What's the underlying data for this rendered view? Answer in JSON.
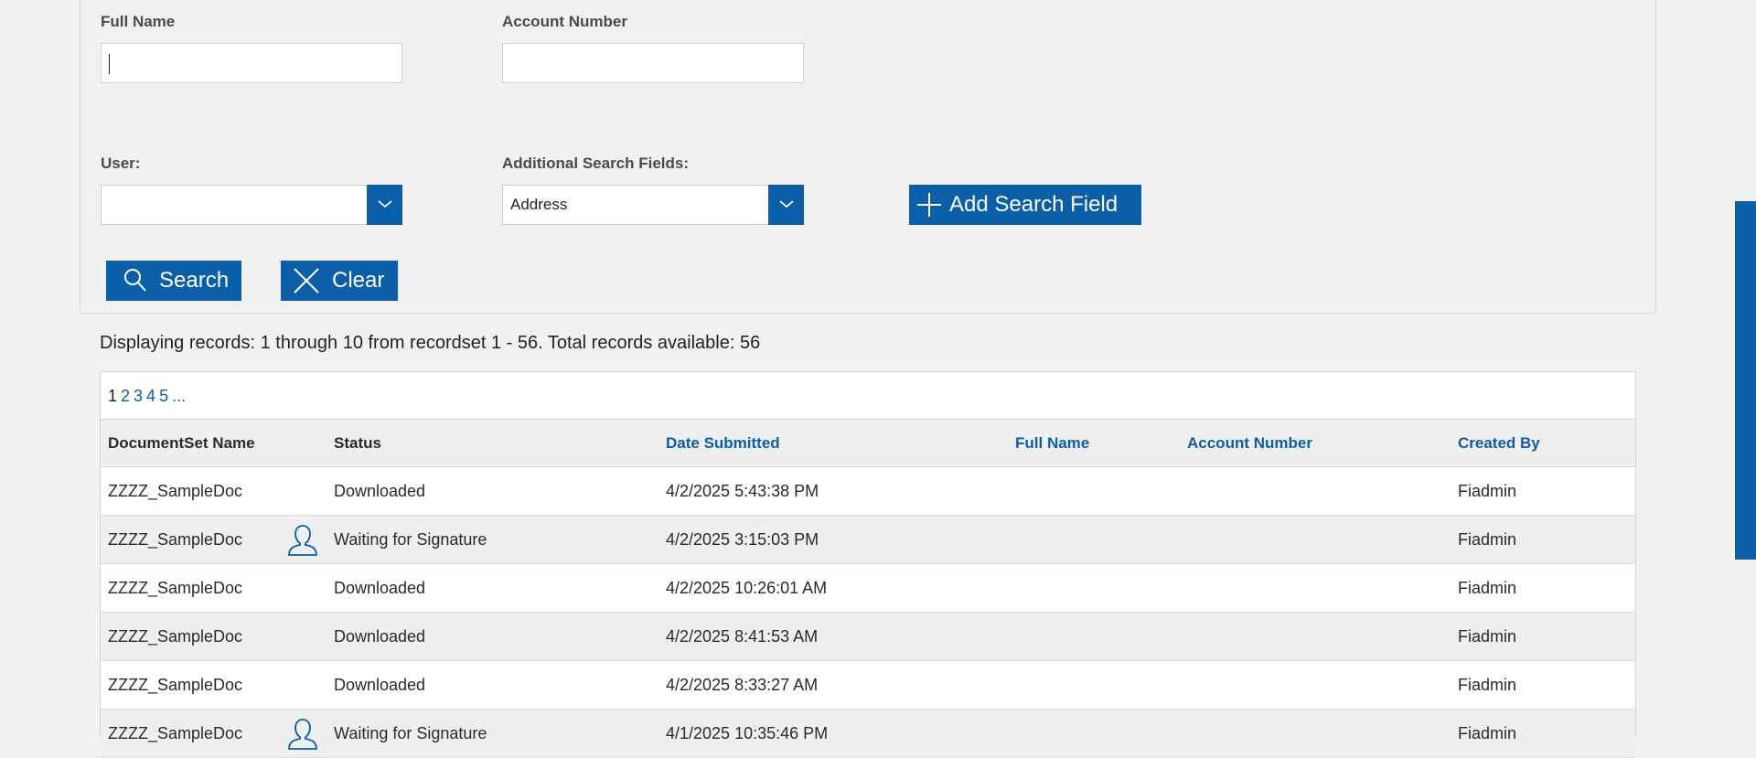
{
  "search": {
    "full_name_label": "Full Name",
    "full_name_value": "",
    "account_number_label": "Account Number",
    "account_number_value": "",
    "user_label": "User:",
    "user_value": "",
    "additional_label": "Additional Search Fields:",
    "additional_value": "Address",
    "add_field_label": "Add Search Field",
    "search_label": "Search",
    "clear_label": "Clear"
  },
  "records_info": "Displaying records: 1 through 10 from recordset 1 - 56. Total records available: 56",
  "pager": {
    "current": "1",
    "pages": [
      "2",
      "3",
      "4",
      "5",
      "..."
    ]
  },
  "table": {
    "headers": {
      "name": "DocumentSet Name",
      "status": "Status",
      "date": "Date Submitted",
      "full_name": "Full Name",
      "account": "Account Number",
      "created_by": "Created By"
    },
    "rows": [
      {
        "name": "ZZZZ_SampleDoc",
        "status": "Downloaded",
        "date": "4/2/2025 5:43:38 PM",
        "full_name": "",
        "account": "",
        "created_by": "Fiadmin",
        "signer_icon": false
      },
      {
        "name": "ZZZZ_SampleDoc",
        "status": "Waiting for Signature",
        "date": "4/2/2025 3:15:03 PM",
        "full_name": "",
        "account": "",
        "created_by": "Fiadmin",
        "signer_icon": true
      },
      {
        "name": "ZZZZ_SampleDoc",
        "status": "Downloaded",
        "date": "4/2/2025 10:26:01 AM",
        "full_name": "",
        "account": "",
        "created_by": "Fiadmin",
        "signer_icon": false
      },
      {
        "name": "ZZZZ_SampleDoc",
        "status": "Downloaded",
        "date": "4/2/2025 8:41:53 AM",
        "full_name": "",
        "account": "",
        "created_by": "Fiadmin",
        "signer_icon": false
      },
      {
        "name": "ZZZZ_SampleDoc",
        "status": "Downloaded",
        "date": "4/2/2025 8:33:27 AM",
        "full_name": "",
        "account": "",
        "created_by": "Fiadmin",
        "signer_icon": false
      },
      {
        "name": "ZZZZ_SampleDoc",
        "status": "Waiting for Signature",
        "date": "4/1/2025 10:35:46 PM",
        "full_name": "",
        "account": "",
        "created_by": "Fiadmin",
        "signer_icon": true
      }
    ]
  },
  "colors": {
    "accent": "#0b5ea8",
    "background": "#f1f1f1",
    "row_alt": "#efefef"
  },
  "icons": {
    "search": "search-icon",
    "clear": "close-icon",
    "add": "plus-icon",
    "dropdown": "chevron-down-icon",
    "signer": "user-icon"
  }
}
